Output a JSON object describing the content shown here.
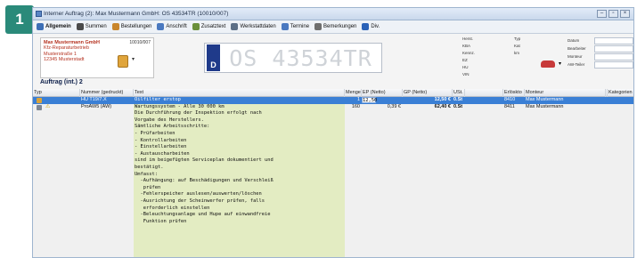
{
  "step_number": "1",
  "window": {
    "title": "Interner Auftrag (2): Max Mustermann GmbH: OS 43534TR (10010/007)"
  },
  "toolbar": {
    "items": [
      {
        "label": "Allgemein",
        "icon": "home-icon",
        "color": "#3d6fb6"
      },
      {
        "label": "Summen",
        "icon": "euro-icon",
        "color": "#4a4a4a"
      },
      {
        "label": "Bestellungen",
        "icon": "order-icon",
        "color": "#c9862c"
      },
      {
        "label": "Anschrift",
        "icon": "address-icon",
        "color": "#4a79c0"
      },
      {
        "label": "Zusatztext",
        "icon": "note-icon",
        "color": "#6a8f3a"
      },
      {
        "label": "Werkstattdaten",
        "icon": "wrench-icon",
        "color": "#5c6f86"
      },
      {
        "label": "Termine",
        "icon": "calendar-icon",
        "color": "#4a79c0"
      },
      {
        "label": "Bemerkungen",
        "icon": "comment-icon",
        "color": "#6e6e6e"
      },
      {
        "label": "Div.",
        "icon": "info-icon",
        "color": "#2a62b8"
      }
    ]
  },
  "customer": {
    "name": "Max Mustermann GmbH",
    "line2": "Kfz-Reparaturbetrieb",
    "street": "Musterstraße 1",
    "city": "12345 Musterstadt",
    "number": "10010/007"
  },
  "order_label": "Auftrag (int.) 2",
  "plate": {
    "country": "D",
    "number": "OS 43534TR"
  },
  "vehicle_fields": {
    "col1": [
      "Herst.",
      "KBA",
      "Kennz.",
      "EZ",
      "HU",
      "VIN"
    ],
    "col2": [
      "Typ",
      "Kat",
      "km"
    ]
  },
  "date_fields": [
    "Datum",
    "Bearbeiter",
    "Monteur",
    "AW-Teiler"
  ],
  "grid": {
    "headers": [
      "Typ",
      "Nummer (gedruckt)",
      "Text",
      "Menge",
      "EP (Netto)",
      "GP (Netto)",
      "USt.",
      "",
      "Erlöskto",
      "Monteur",
      "",
      "Kategorien"
    ],
    "rows": [
      {
        "nummer": "HU T19/7.X",
        "text": "Oilfilter erstop",
        "menge": "1",
        "ep": "12,50",
        "gp": "12,50 €",
        "ust": "0.St",
        "erlos": "8410",
        "monteur": "Max Mustermann",
        "selected": true,
        "warn": false
      },
      {
        "nummer": "ProAW5 (AW)",
        "text": "Wartungssystem - Alle 30 000 km",
        "menge": "160",
        "ep": "0,39 €",
        "gp": "62,40 €",
        "ust": "0.St",
        "erlos": "8411",
        "monteur": "Max Mustermann",
        "selected": false,
        "warn": true
      }
    ],
    "text_lines": [
      "Die Durchführung der Inspektion erfolgt nach",
      "Vorgabe des Herstellers.",
      "Sämtliche Arbeitsschritte:",
      "- Prüfarbeiten",
      "- Kontrollarbeiten",
      "- Einstellarbeiten",
      "- Austauscharbeiten",
      "sind im beigefügten Serviceplan dokumentiert und",
      "bestätigt.",
      "Umfasst:",
      "  -Aufhängung: auf Beschädigungen und Verschleiß",
      "   prüfen",
      "  -Fehlerspeicher auslesen/auswerten/löschen",
      "  -Ausrichtung der Scheinwerfer prüfen, falls",
      "   erforderlich einstellen",
      "  -Beleuchtungsanlage und Hupe auf einwandfreie",
      "   Funktion prüfen"
    ]
  }
}
